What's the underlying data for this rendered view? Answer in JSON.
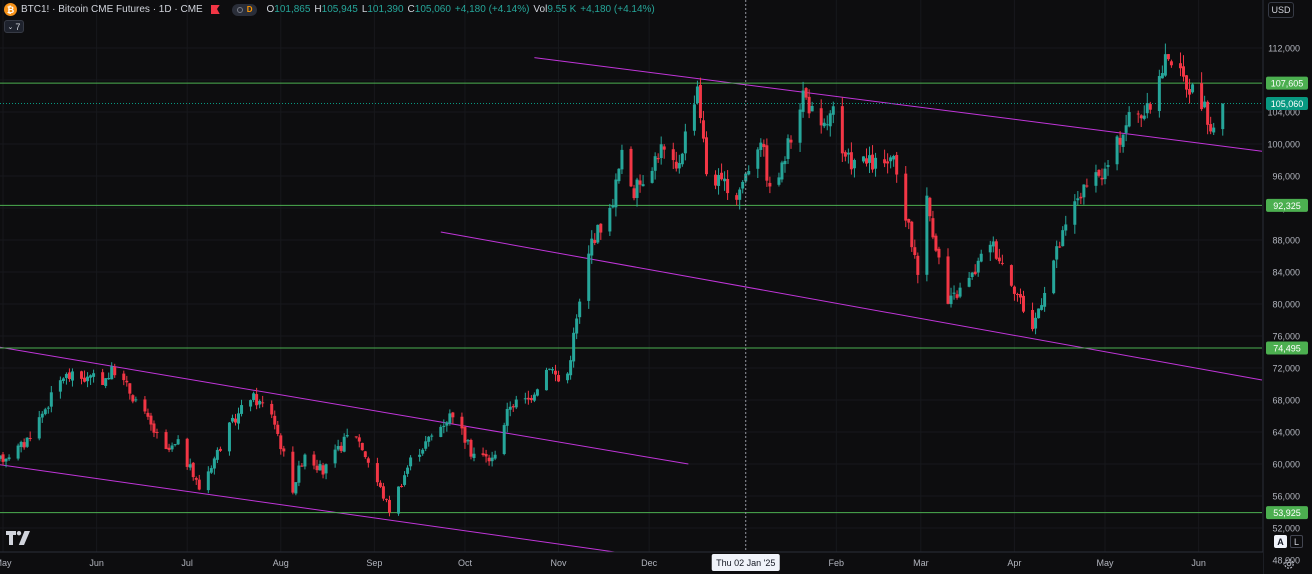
{
  "header": {
    "logo_glyph": "₿",
    "title": "BTC1! · Bitcoin CME Futures · 1D · CME",
    "interval_letter": "D",
    "ohlc": [
      {
        "k": "O",
        "v": "101,865"
      },
      {
        "k": "H",
        "v": "105,945"
      },
      {
        "k": "L",
        "v": "101,390"
      },
      {
        "k": "C",
        "v": "105,060"
      }
    ],
    "change": "+4,180 (+4.14%)",
    "vol_label": "Vol",
    "vol_value": "9.55 K",
    "vol_change": "+4,180 (+4.14%)",
    "collapse_count": "7"
  },
  "currency_button": "USD",
  "crosshair_date_label": "Thu 02 Jan '25",
  "colors": {
    "background": "#0d0d0f",
    "up": "#26a69a",
    "down": "#f23645",
    "hline": "#4caf50",
    "hline_label_bg": "#4caf50",
    "price_label_bg": "#089981",
    "channel": "#c035d9",
    "axis_text": "#b2b5be"
  },
  "controls": {
    "auto_label": "A",
    "log_label": "L"
  },
  "icons": [
    "tradingview-logo-icon",
    "settings-gear-icon",
    "live-indicator-icon",
    "flag-icon"
  ],
  "chart_data": {
    "type": "candlestick",
    "title": "BTC1! · Bitcoin CME Futures · 1D · CME",
    "ylim": [
      46000,
      114500
    ],
    "y_ticks": [
      {
        "v": 112000,
        "label": "112,000"
      },
      {
        "v": 108000,
        "label": "108,000"
      },
      {
        "v": 104000,
        "label": "104,000"
      },
      {
        "v": 100000,
        "label": "100,000"
      },
      {
        "v": 96000,
        "label": "96,000"
      },
      {
        "v": 92000,
        "label": "92,000"
      },
      {
        "v": 88000,
        "label": "88,000"
      },
      {
        "v": 84000,
        "label": "84,000"
      },
      {
        "v": 80000,
        "label": "80,000"
      },
      {
        "v": 76000,
        "label": "76,000"
      },
      {
        "v": 72000,
        "label": "72,000"
      },
      {
        "v": 68000,
        "label": "68,000"
      },
      {
        "v": 64000,
        "label": "64,000"
      },
      {
        "v": 60000,
        "label": "60,000"
      },
      {
        "v": 56000,
        "label": "56,000"
      },
      {
        "v": 52000,
        "label": "52,000"
      },
      {
        "v": 48000,
        "label": "48,000"
      }
    ],
    "x_ticks": [
      {
        "date": "2024-05-01",
        "label": "May"
      },
      {
        "date": "2024-06-01",
        "label": "Jun"
      },
      {
        "date": "2024-07-01",
        "label": "Jul"
      },
      {
        "date": "2024-08-01",
        "label": "Aug"
      },
      {
        "date": "2024-09-01",
        "label": "Sep"
      },
      {
        "date": "2024-10-01",
        "label": "Oct"
      },
      {
        "date": "2024-11-01",
        "label": "Nov"
      },
      {
        "date": "2024-12-01",
        "label": "Dec"
      },
      {
        "date": "2025-02-01",
        "label": "Feb"
      },
      {
        "date": "2025-03-01",
        "label": "Mar"
      },
      {
        "date": "2025-04-01",
        "label": "Apr"
      },
      {
        "date": "2025-05-01",
        "label": "May"
      },
      {
        "date": "2025-06-01",
        "label": "Jun"
      }
    ],
    "x_range": [
      "2024-04-30",
      "2025-06-22"
    ],
    "crosshair_date": "2025-01-02",
    "horizontal_levels": [
      {
        "value": 107605,
        "label": "107,605"
      },
      {
        "value": 92325,
        "label": "92,325"
      },
      {
        "value": 74495,
        "label": "74,495"
      },
      {
        "value": 53925,
        "label": "53,925"
      }
    ],
    "last_price": {
      "value": 105060,
      "label": "105,060"
    },
    "trend_lines": [
      {
        "from": [
          "2024-10-24",
          110800
        ],
        "to": [
          "2025-06-22",
          99100
        ]
      },
      {
        "from": [
          "2024-09-23",
          89000
        ],
        "to": [
          "2025-06-22",
          70500
        ]
      },
      {
        "from": [
          "2024-04-30",
          74600
        ],
        "to": [
          "2024-12-14",
          60000
        ]
      },
      {
        "from": [
          "2024-04-30",
          59900
        ],
        "to": [
          "2024-11-27",
          48600
        ]
      }
    ],
    "series": [
      {
        "name": "BTC1!",
        "anchors": [
          [
            "2024-04-30",
            60500
          ],
          [
            "2024-05-08",
            62500
          ],
          [
            "2024-05-15",
            67000
          ],
          [
            "2024-05-21",
            71000
          ],
          [
            "2024-06-03",
            70500
          ],
          [
            "2024-06-07",
            71800
          ],
          [
            "2024-06-14",
            68000
          ],
          [
            "2024-06-24",
            61500
          ],
          [
            "2024-06-28",
            62500
          ],
          [
            "2024-07-05",
            57000
          ],
          [
            "2024-07-15",
            64500
          ],
          [
            "2024-07-22",
            68500
          ],
          [
            "2024-07-29",
            66500
          ],
          [
            "2024-08-05",
            57000
          ],
          [
            "2024-08-09",
            61500
          ],
          [
            "2024-08-15",
            59000
          ],
          [
            "2024-08-25",
            64500
          ],
          [
            "2024-08-31",
            59500
          ],
          [
            "2024-09-06",
            54300
          ],
          [
            "2024-09-13",
            60500
          ],
          [
            "2024-09-20",
            63500
          ],
          [
            "2024-09-27",
            66500
          ],
          [
            "2024-10-03",
            61500
          ],
          [
            "2024-10-10",
            60500
          ],
          [
            "2024-10-16",
            67500
          ],
          [
            "2024-10-22",
            68000
          ],
          [
            "2024-10-29",
            72500
          ],
          [
            "2024-11-03",
            69000
          ],
          [
            "2024-11-06",
            76000
          ],
          [
            "2024-11-12",
            88000
          ],
          [
            "2024-11-18",
            91500
          ],
          [
            "2024-11-22",
            98500
          ],
          [
            "2024-11-26",
            94000
          ],
          [
            "2024-12-05",
            99500
          ],
          [
            "2024-12-10",
            96500
          ],
          [
            "2024-12-17",
            107500
          ],
          [
            "2024-12-20",
            96500
          ],
          [
            "2024-12-30",
            93500
          ],
          [
            "2025-01-07",
            101000
          ],
          [
            "2025-01-10",
            94000
          ],
          [
            "2025-01-14",
            97000
          ],
          [
            "2025-01-21",
            106500
          ],
          [
            "2025-01-27",
            101500
          ],
          [
            "2025-01-31",
            104000
          ],
          [
            "2025-02-03",
            98000
          ],
          [
            "2025-02-14",
            97500
          ],
          [
            "2025-02-20",
            97500
          ],
          [
            "2025-02-28",
            84500
          ],
          [
            "2025-03-03",
            93000
          ],
          [
            "2025-03-10",
            80000
          ],
          [
            "2025-03-18",
            83500
          ],
          [
            "2025-03-24",
            88000
          ],
          [
            "2025-03-31",
            83000
          ],
          [
            "2025-04-07",
            77000
          ],
          [
            "2025-04-13",
            84500
          ],
          [
            "2025-04-22",
            93500
          ],
          [
            "2025-05-01",
            96500
          ],
          [
            "2025-05-09",
            103500
          ],
          [
            "2025-05-15",
            104000
          ],
          [
            "2025-05-22",
            111500
          ],
          [
            "2025-05-26",
            108500
          ],
          [
            "2025-06-02",
            105500
          ],
          [
            "2025-06-05",
            101800
          ],
          [
            "2025-06-09",
            105060
          ]
        ]
      }
    ]
  }
}
